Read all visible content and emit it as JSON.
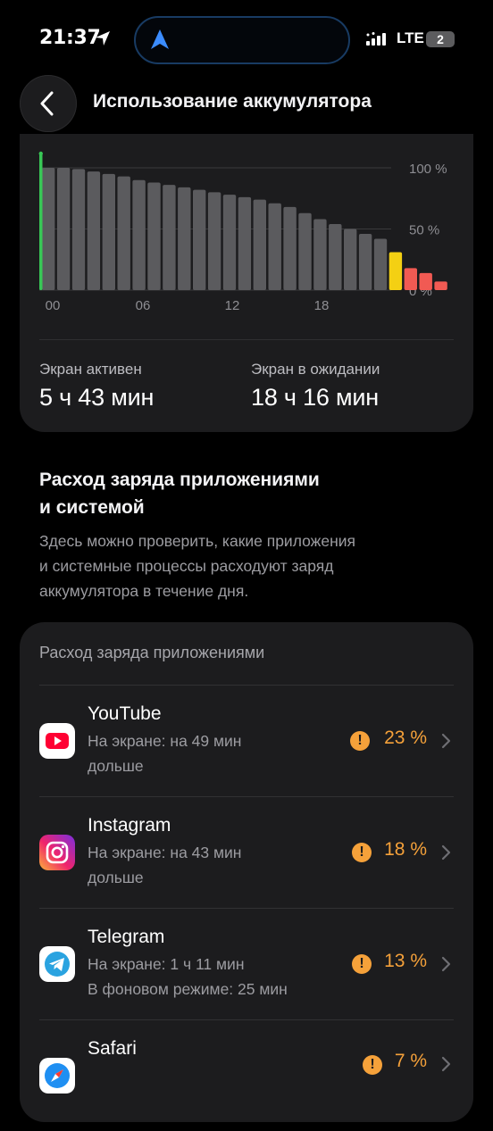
{
  "status_bar": {
    "time": "21:37",
    "network": "LTE",
    "sim_badge": "2",
    "location_icon": "location-arrow-icon",
    "island_icon": "navigation-arrow-icon",
    "signal_icon": "cell-signal-icon"
  },
  "header": {
    "title": "Использование аккумулятора",
    "back_icon": "chevron-left-icon"
  },
  "chart_data": {
    "type": "bar",
    "x_tick_labels": [
      "00",
      "06",
      "12",
      "18"
    ],
    "y_tick_labels": [
      "100 %",
      "50 %",
      "0 %"
    ],
    "ylim": [
      0,
      100
    ],
    "grid": true,
    "values": [
      100,
      100,
      99,
      97,
      95,
      93,
      90,
      88,
      86,
      84,
      82,
      80,
      78,
      76,
      74,
      71,
      68,
      63,
      58,
      54,
      50,
      46,
      42,
      31,
      18,
      14,
      7
    ],
    "charging_marker_value": 100,
    "colors": {
      "normal": "#5b5b5e",
      "medium": "#f4d013",
      "low": "#f15a53",
      "charging": "#38c756",
      "grid": "#3a3a3c",
      "axis_text": "#8e8e93"
    },
    "medium_indices": [
      23
    ],
    "low_indices": [
      24,
      25,
      26
    ]
  },
  "usage": {
    "screen_on_label": "Экран активен",
    "screen_on_value": "5 ч 43 мин",
    "screen_off_label": "Экран в ожидании",
    "screen_off_value": "18 ч 16 мин"
  },
  "section": {
    "title_line1": "Расход заряда приложениями",
    "title_line2": "и системой",
    "desc_line1": "Здесь можно проверить, какие приложения",
    "desc_line2": "и системные процессы расходуют заряд",
    "desc_line3": "аккумулятора в течение дня."
  },
  "apps": {
    "header": "Расход заряда приложениями",
    "accent_color": "#f5a13a",
    "items": [
      {
        "name": "YouTube",
        "detail1": "На экране: на 49 мин",
        "detail2": "дольше",
        "percent": "23 %",
        "icon": "youtube-icon"
      },
      {
        "name": "Instagram",
        "detail1": "На экране: на 43 мин",
        "detail2": "дольше",
        "percent": "18 %",
        "icon": "instagram-icon"
      },
      {
        "name": "Telegram",
        "detail1": "На экране: 1 ч 11 мин",
        "detail2": "В фоновом режиме: 25 мин",
        "percent": "13 %",
        "icon": "telegram-icon"
      },
      {
        "name": "Safari",
        "detail1": "",
        "detail2": "",
        "percent": "7 %",
        "icon": "safari-icon"
      }
    ]
  }
}
